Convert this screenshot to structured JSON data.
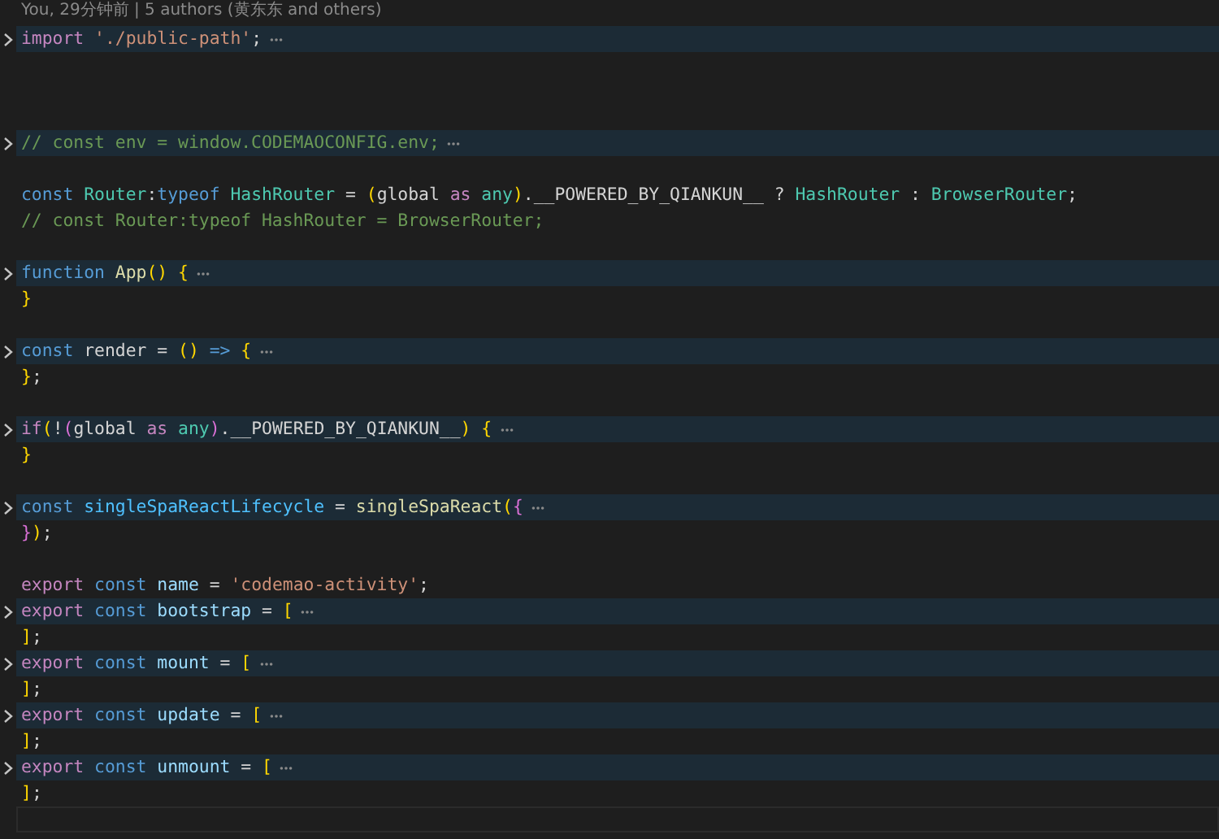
{
  "blame": {
    "text": "You, 29分钟前 | 5 authors (黄东东 and others)"
  },
  "lines": [
    {
      "folded": true,
      "tokens": [
        {
          "text": "import ",
          "kind": "keyword"
        },
        {
          "text": "'./public-path'",
          "kind": "string"
        },
        {
          "text": ";",
          "kind": "plain"
        }
      ]
    },
    {
      "folded": false
    },
    {
      "folded": false
    },
    {
      "folded": false
    },
    {
      "folded": true,
      "tokens": [
        {
          "text": "// const env = window.CODEMAOCONFIG.env;",
          "kind": "comment"
        }
      ]
    },
    {
      "folded": false
    },
    {
      "folded": false,
      "tokens": [
        {
          "text": "const ",
          "kind": "storage"
        },
        {
          "text": "Router",
          "kind": "type"
        },
        {
          "text": ":",
          "kind": "plain"
        },
        {
          "text": "typeof ",
          "kind": "storage"
        },
        {
          "text": "HashRouter",
          "kind": "type"
        },
        {
          "text": " = ",
          "kind": "plain"
        },
        {
          "text": "(",
          "kind": "bracket1"
        },
        {
          "text": "global ",
          "kind": "plain"
        },
        {
          "text": "as ",
          "kind": "keyword"
        },
        {
          "text": "any",
          "kind": "type"
        },
        {
          "text": ")",
          "kind": "bracket1"
        },
        {
          "text": ".__POWERED_BY_QIANKUN__ ? ",
          "kind": "plain"
        },
        {
          "text": "HashRouter",
          "kind": "type"
        },
        {
          "text": " : ",
          "kind": "plain"
        },
        {
          "text": "BrowserRouter",
          "kind": "type"
        },
        {
          "text": ";",
          "kind": "plain"
        }
      ]
    },
    {
      "folded": false,
      "tokens": [
        {
          "text": "// const Router:typeof HashRouter = BrowserRouter;",
          "kind": "comment"
        }
      ]
    },
    {
      "folded": false
    },
    {
      "folded": true,
      "tokens": [
        {
          "text": "function ",
          "kind": "storage"
        },
        {
          "text": "App",
          "kind": "function"
        },
        {
          "text": "() {",
          "kind": "bracket1"
        }
      ]
    },
    {
      "folded": false,
      "tokens": [
        {
          "text": "}",
          "kind": "bracket1"
        }
      ]
    },
    {
      "folded": false
    },
    {
      "folded": true,
      "tokens": [
        {
          "text": "const ",
          "kind": "storage"
        },
        {
          "text": "render = ",
          "kind": "plain"
        },
        {
          "text": "() ",
          "kind": "bracket1"
        },
        {
          "text": "=> ",
          "kind": "storage"
        },
        {
          "text": "{",
          "kind": "bracket1"
        }
      ]
    },
    {
      "folded": false,
      "tokens": [
        {
          "text": "}",
          "kind": "bracket1"
        },
        {
          "text": ";",
          "kind": "plain"
        }
      ]
    },
    {
      "folded": false
    },
    {
      "folded": true,
      "tokens": [
        {
          "text": "if",
          "kind": "keyword"
        },
        {
          "text": "(",
          "kind": "bracket1"
        },
        {
          "text": "!",
          "kind": "plain"
        },
        {
          "text": "(",
          "kind": "bracket2"
        },
        {
          "text": "global ",
          "kind": "plain"
        },
        {
          "text": "as ",
          "kind": "keyword"
        },
        {
          "text": "any",
          "kind": "type"
        },
        {
          "text": ")",
          "kind": "bracket2"
        },
        {
          "text": ".__POWERED_BY_QIANKUN__",
          "kind": "plain"
        },
        {
          "text": ") {",
          "kind": "bracket1"
        }
      ]
    },
    {
      "folded": false,
      "tokens": [
        {
          "text": "}",
          "kind": "bracket1"
        }
      ]
    },
    {
      "folded": false
    },
    {
      "folded": true,
      "tokens": [
        {
          "text": "const ",
          "kind": "storage"
        },
        {
          "text": "singleSpaReactLifecycle",
          "kind": "constant"
        },
        {
          "text": " = ",
          "kind": "plain"
        },
        {
          "text": "singleSpaReact",
          "kind": "function"
        },
        {
          "text": "(",
          "kind": "bracket1"
        },
        {
          "text": "{",
          "kind": "bracket2"
        }
      ]
    },
    {
      "folded": false,
      "tokens": [
        {
          "text": "}",
          "kind": "bracket2"
        },
        {
          "text": ")",
          "kind": "bracket1"
        },
        {
          "text": ";",
          "kind": "plain"
        }
      ]
    },
    {
      "folded": false
    },
    {
      "folded": false,
      "tokens": [
        {
          "text": "export ",
          "kind": "keyword"
        },
        {
          "text": "const ",
          "kind": "storage"
        },
        {
          "text": "name",
          "kind": "variable"
        },
        {
          "text": " = ",
          "kind": "plain"
        },
        {
          "text": "'codemao-activity'",
          "kind": "string"
        },
        {
          "text": ";",
          "kind": "plain"
        }
      ]
    },
    {
      "folded": true,
      "tokens": [
        {
          "text": "export ",
          "kind": "keyword"
        },
        {
          "text": "const ",
          "kind": "storage"
        },
        {
          "text": "bootstrap",
          "kind": "variable"
        },
        {
          "text": " = ",
          "kind": "plain"
        },
        {
          "text": "[",
          "kind": "bracket1"
        }
      ]
    },
    {
      "folded": false,
      "tokens": [
        {
          "text": "]",
          "kind": "bracket1"
        },
        {
          "text": ";",
          "kind": "plain"
        }
      ]
    },
    {
      "folded": true,
      "tokens": [
        {
          "text": "export ",
          "kind": "keyword"
        },
        {
          "text": "const ",
          "kind": "storage"
        },
        {
          "text": "mount",
          "kind": "variable"
        },
        {
          "text": " = ",
          "kind": "plain"
        },
        {
          "text": "[",
          "kind": "bracket1"
        }
      ]
    },
    {
      "folded": false,
      "tokens": [
        {
          "text": "]",
          "kind": "bracket1"
        },
        {
          "text": ";",
          "kind": "plain"
        }
      ]
    },
    {
      "folded": true,
      "tokens": [
        {
          "text": "export ",
          "kind": "keyword"
        },
        {
          "text": "const ",
          "kind": "storage"
        },
        {
          "text": "update",
          "kind": "variable"
        },
        {
          "text": " = ",
          "kind": "plain"
        },
        {
          "text": "[",
          "kind": "bracket1"
        }
      ]
    },
    {
      "folded": false,
      "tokens": [
        {
          "text": "]",
          "kind": "bracket1"
        },
        {
          "text": ";",
          "kind": "plain"
        }
      ]
    },
    {
      "folded": true,
      "tokens": [
        {
          "text": "export ",
          "kind": "keyword"
        },
        {
          "text": "const ",
          "kind": "storage"
        },
        {
          "text": "unmount",
          "kind": "variable"
        },
        {
          "text": " = ",
          "kind": "plain"
        },
        {
          "text": "[",
          "kind": "bracket1"
        }
      ]
    },
    {
      "folded": false,
      "tokens": [
        {
          "text": "]",
          "kind": "bracket1"
        },
        {
          "text": ";",
          "kind": "plain"
        }
      ]
    },
    {
      "folded": false,
      "current": true
    }
  ]
}
